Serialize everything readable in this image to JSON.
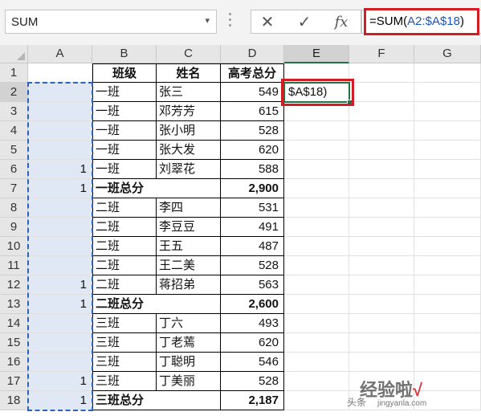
{
  "name_box": {
    "value": "SUM",
    "dropdown_glyph": "▾"
  },
  "formula_bar": {
    "cancel_glyph": "✕",
    "enter_glyph": "✓",
    "fx_glyph": "fx",
    "formula_prefix": "=SUM(",
    "formula_ref": "A2:$A$18",
    "formula_suffix": ")"
  },
  "columns": [
    "A",
    "B",
    "C",
    "D",
    "E",
    "F",
    "G"
  ],
  "rows": [
    "1",
    "2",
    "3",
    "4",
    "5",
    "6",
    "7",
    "8",
    "9",
    "10",
    "11",
    "12",
    "13",
    "14",
    "15",
    "16",
    "17",
    "18"
  ],
  "table": {
    "header": {
      "class": "班级",
      "name": "姓名",
      "score": "高考总分"
    },
    "data": [
      {
        "a": "",
        "class": "一班",
        "name": "张三",
        "score": "549"
      },
      {
        "a": "",
        "class": "一班",
        "name": "邓芳芳",
        "score": "615"
      },
      {
        "a": "",
        "class": "一班",
        "name": "张小明",
        "score": "528"
      },
      {
        "a": "",
        "class": "一班",
        "name": "张大发",
        "score": "620"
      },
      {
        "a": "1",
        "class": "一班",
        "name": "刘翠花",
        "score": "588"
      },
      {
        "a": "1",
        "class": "一班总分",
        "name": "",
        "score": "2,900",
        "total": true
      },
      {
        "a": "",
        "class": "二班",
        "name": "李四",
        "score": "531"
      },
      {
        "a": "",
        "class": "二班",
        "name": "李豆豆",
        "score": "491"
      },
      {
        "a": "",
        "class": "二班",
        "name": "王五",
        "score": "487"
      },
      {
        "a": "",
        "class": "二班",
        "name": "王二美",
        "score": "528"
      },
      {
        "a": "1",
        "class": "二班",
        "name": "蒋招弟",
        "score": "563"
      },
      {
        "a": "1",
        "class": "二班总分",
        "name": "",
        "score": "2,600",
        "total": true
      },
      {
        "a": "",
        "class": "三班",
        "name": "丁六",
        "score": "493"
      },
      {
        "a": "",
        "class": "三班",
        "name": "丁老蔫",
        "score": "620"
      },
      {
        "a": "",
        "class": "三班",
        "name": "丁聪明",
        "score": "546"
      },
      {
        "a": "1",
        "class": "三班",
        "name": "丁美丽",
        "score": "528"
      },
      {
        "a": "1",
        "class": "三班总分",
        "name": "",
        "score": "2,187",
        "total": true
      }
    ]
  },
  "editing_cell": {
    "value": "$A$18)"
  },
  "watermark": {
    "main": "经验啦",
    "tick": "√",
    "small": "头条",
    "site": "jingyanla.com"
  },
  "colors": {
    "accent_green": "#217346",
    "highlight_red": "#d41c24",
    "ref_blue": "#1f56b8"
  }
}
